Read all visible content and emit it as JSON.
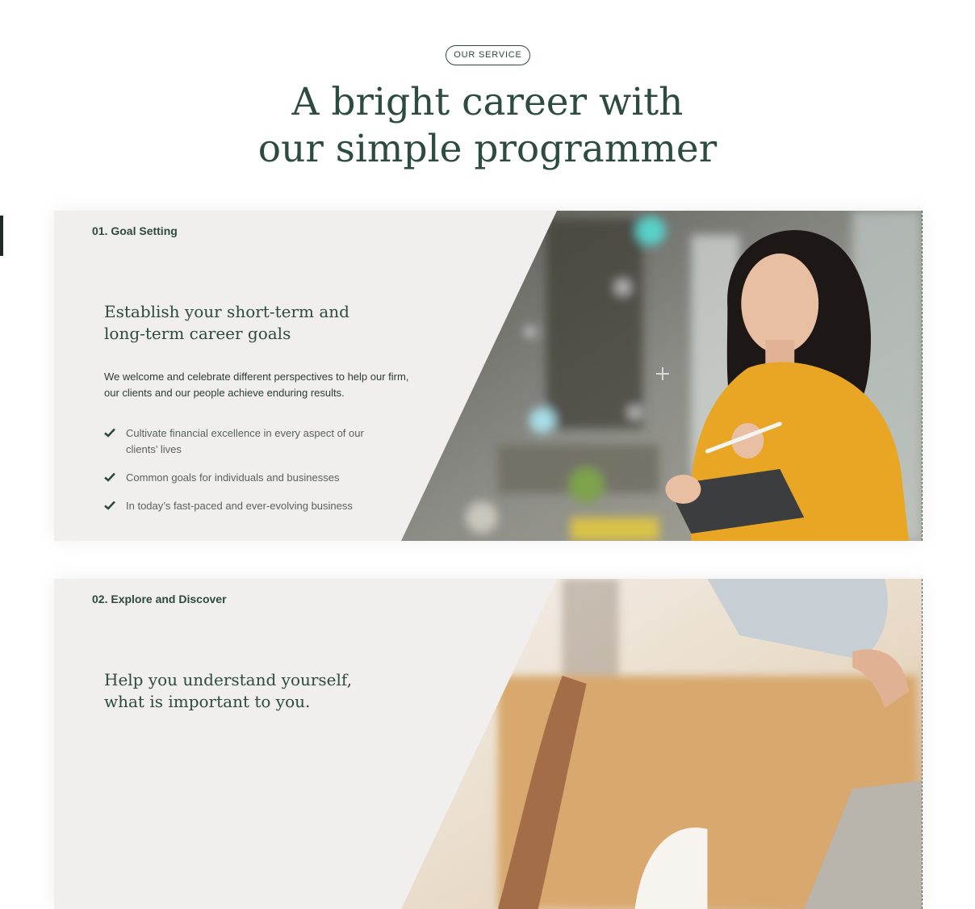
{
  "section": {
    "badge": "OUR SERVICE",
    "title_line1": "A bright career with",
    "title_line2": "our simple programmer"
  },
  "cards": [
    {
      "number": "01. Goal Setting",
      "heading": "Establish your short-term and long-term career goals",
      "description": "We welcome and celebrate different perspectives to help our firm, our clients and our people achieve enduring results.",
      "items": [
        "Cultivate financial excellence in every aspect of our clients’ lives",
        "Common goals for individuals and businesses",
        "In today’s fast-paced and ever-evolving business"
      ],
      "image": "woman-holding-tablet-photo"
    },
    {
      "number": "02. Explore and Discover",
      "heading": "Help you understand yourself, what is important to you.",
      "image": "people-working-at-laptop-photo"
    }
  ],
  "colors": {
    "brand_green": "#2d4b40",
    "card_background": "#f1efed",
    "check_icon": "#2e4a40"
  }
}
